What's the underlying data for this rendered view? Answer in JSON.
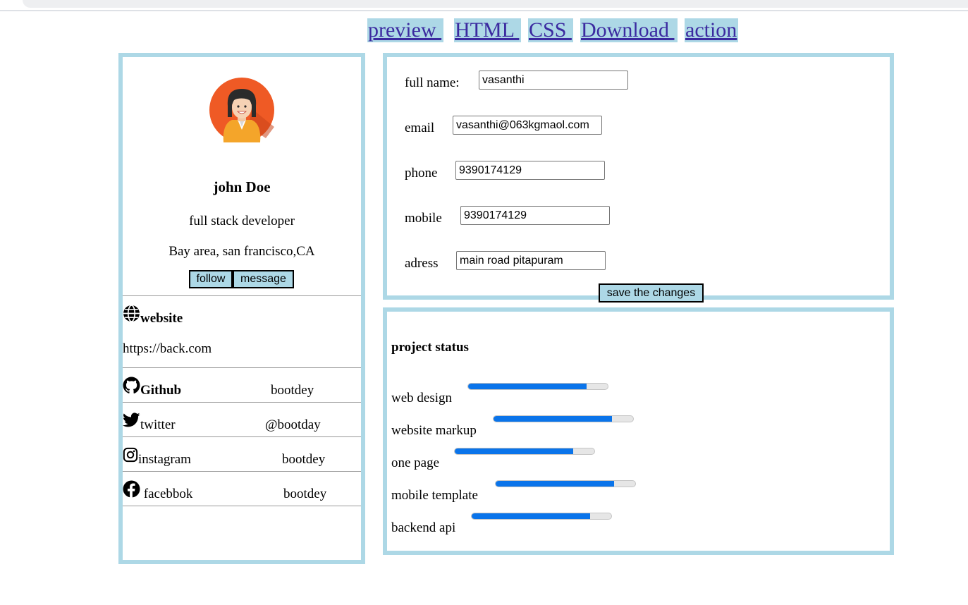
{
  "nav": {
    "items": [
      {
        "label": "preview "
      },
      {
        "label": "HTML "
      },
      {
        "label": "CSS "
      },
      {
        "label": "Download "
      },
      {
        "label": "action"
      }
    ]
  },
  "profile": {
    "name": "john Doe",
    "role": "full stack developer",
    "location": "Bay area, san francisco,CA",
    "follow_label": "follow",
    "message_label": "message"
  },
  "links": {
    "website_label": "website",
    "website_url": "https://back.com",
    "github_label": "Github",
    "github_value": "bootdey",
    "twitter_label": "twitter",
    "twitter_value": "@bootday",
    "instagram_label": "instagram",
    "instagram_value": "bootdey",
    "facebook_label": " facebbok",
    "facebook_value": "bootdey"
  },
  "form": {
    "fullname_label": "full name:",
    "fullname_value": "vasanthi",
    "email_label": "email",
    "email_value": "vasanthi@063kgmaol.com",
    "phone_label": "phone",
    "phone_value": "9390174129",
    "mobile_label": "mobile",
    "mobile_value": "9390174129",
    "address_label": "adress",
    "address_value": "main road pitapuram",
    "save_label": "save the changes"
  },
  "project": {
    "title": "project status",
    "items": [
      {
        "label": "web design",
        "progress": 0.85
      },
      {
        "label": "website markup",
        "progress": 0.85
      },
      {
        "label": "one page",
        "progress": 0.85
      },
      {
        "label": "mobile template",
        "progress": 0.85
      },
      {
        "label": "backend api",
        "progress": 0.85
      }
    ]
  },
  "colors": {
    "accent": "#add8e6",
    "progress": "#0a74ea",
    "link": "#3b2aa0"
  }
}
